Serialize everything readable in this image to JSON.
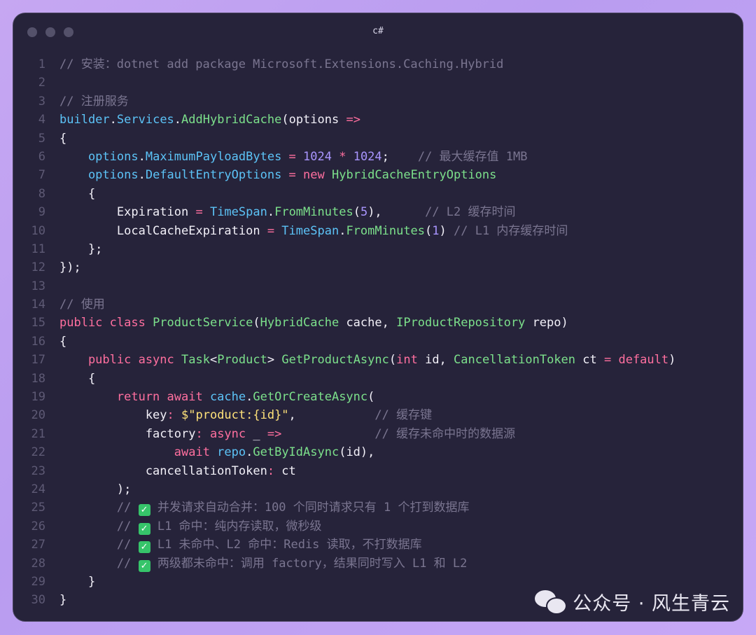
{
  "window": {
    "title": "c#"
  },
  "colors": {
    "background": "#26233a",
    "comment": "#7a7590",
    "keyword": "#ff6f9f",
    "type": "#7ce08b",
    "identifier": "#5cc3f7",
    "number": "#a995ff",
    "string": "#ffe27a"
  },
  "code": {
    "lines": [
      {
        "n": "1",
        "tokens": [
          {
            "t": "// 安装：dotnet add package Microsoft.Extensions.Caching.Hybrid",
            "c": "com"
          }
        ]
      },
      {
        "n": "2",
        "tokens": []
      },
      {
        "n": "3",
        "tokens": [
          {
            "t": "// 注册服务",
            "c": "com"
          }
        ]
      },
      {
        "n": "4",
        "tokens": [
          {
            "t": "builder",
            "c": "id"
          },
          {
            "t": ".",
            "c": "pl"
          },
          {
            "t": "Services",
            "c": "id"
          },
          {
            "t": ".",
            "c": "pl"
          },
          {
            "t": "AddHybridCache",
            "c": "fn"
          },
          {
            "t": "(options ",
            "c": "pl"
          },
          {
            "t": "=>",
            "c": "op"
          }
        ]
      },
      {
        "n": "5",
        "tokens": [
          {
            "t": "{",
            "c": "pl"
          }
        ]
      },
      {
        "n": "6",
        "tokens": [
          {
            "t": "    options",
            "c": "id"
          },
          {
            "t": ".",
            "c": "pl"
          },
          {
            "t": "MaximumPayloadBytes",
            "c": "id"
          },
          {
            "t": " = ",
            "c": "op"
          },
          {
            "t": "1024",
            "c": "num"
          },
          {
            "t": " * ",
            "c": "op"
          },
          {
            "t": "1024",
            "c": "num"
          },
          {
            "t": ";    ",
            "c": "pl"
          },
          {
            "t": "// 最大缓存值 1MB",
            "c": "com"
          }
        ]
      },
      {
        "n": "7",
        "tokens": [
          {
            "t": "    options",
            "c": "id"
          },
          {
            "t": ".",
            "c": "pl"
          },
          {
            "t": "DefaultEntryOptions",
            "c": "id"
          },
          {
            "t": " = ",
            "c": "op"
          },
          {
            "t": "new ",
            "c": "kw"
          },
          {
            "t": "HybridCacheEntryOptions",
            "c": "ty"
          }
        ]
      },
      {
        "n": "8",
        "tokens": [
          {
            "t": "    {",
            "c": "pl"
          }
        ]
      },
      {
        "n": "9",
        "tokens": [
          {
            "t": "        Expiration",
            "c": "pl"
          },
          {
            "t": " = ",
            "c": "op"
          },
          {
            "t": "TimeSpan",
            "c": "id"
          },
          {
            "t": ".",
            "c": "pl"
          },
          {
            "t": "FromMinutes",
            "c": "fn"
          },
          {
            "t": "(",
            "c": "pl"
          },
          {
            "t": "5",
            "c": "num"
          },
          {
            "t": "),      ",
            "c": "pl"
          },
          {
            "t": "// L2 缓存时间",
            "c": "com"
          }
        ]
      },
      {
        "n": "10",
        "tokens": [
          {
            "t": "        LocalCacheExpiration",
            "c": "pl"
          },
          {
            "t": " = ",
            "c": "op"
          },
          {
            "t": "TimeSpan",
            "c": "id"
          },
          {
            "t": ".",
            "c": "pl"
          },
          {
            "t": "FromMinutes",
            "c": "fn"
          },
          {
            "t": "(",
            "c": "pl"
          },
          {
            "t": "1",
            "c": "num"
          },
          {
            "t": ") ",
            "c": "pl"
          },
          {
            "t": "// L1 内存缓存时间",
            "c": "com"
          }
        ]
      },
      {
        "n": "11",
        "tokens": [
          {
            "t": "    };",
            "c": "pl"
          }
        ]
      },
      {
        "n": "12",
        "tokens": [
          {
            "t": "});",
            "c": "pl"
          }
        ]
      },
      {
        "n": "13",
        "tokens": []
      },
      {
        "n": "14",
        "tokens": [
          {
            "t": "// 使用",
            "c": "com"
          }
        ]
      },
      {
        "n": "15",
        "tokens": [
          {
            "t": "public class ",
            "c": "kw"
          },
          {
            "t": "ProductService",
            "c": "ty"
          },
          {
            "t": "(",
            "c": "pl"
          },
          {
            "t": "HybridCache",
            "c": "ty"
          },
          {
            "t": " cache, ",
            "c": "pl"
          },
          {
            "t": "IProductRepository",
            "c": "ty"
          },
          {
            "t": " repo)",
            "c": "pl"
          }
        ]
      },
      {
        "n": "16",
        "tokens": [
          {
            "t": "{",
            "c": "pl"
          }
        ]
      },
      {
        "n": "17",
        "tokens": [
          {
            "t": "    public async ",
            "c": "kw"
          },
          {
            "t": "Task",
            "c": "ty"
          },
          {
            "t": "<",
            "c": "pl"
          },
          {
            "t": "Product",
            "c": "ty"
          },
          {
            "t": "> ",
            "c": "pl"
          },
          {
            "t": "GetProductAsync",
            "c": "fn"
          },
          {
            "t": "(",
            "c": "pl"
          },
          {
            "t": "int",
            "c": "kw"
          },
          {
            "t": " id, ",
            "c": "pl"
          },
          {
            "t": "CancellationToken",
            "c": "ty"
          },
          {
            "t": " ct ",
            "c": "pl"
          },
          {
            "t": "= ",
            "c": "op"
          },
          {
            "t": "default",
            "c": "kw"
          },
          {
            "t": ")",
            "c": "pl"
          }
        ]
      },
      {
        "n": "18",
        "tokens": [
          {
            "t": "    {",
            "c": "pl"
          }
        ]
      },
      {
        "n": "19",
        "tokens": [
          {
            "t": "        return await ",
            "c": "kw"
          },
          {
            "t": "cache",
            "c": "id"
          },
          {
            "t": ".",
            "c": "pl"
          },
          {
            "t": "GetOrCreateAsync",
            "c": "fn"
          },
          {
            "t": "(",
            "c": "pl"
          }
        ]
      },
      {
        "n": "20",
        "tokens": [
          {
            "t": "            key",
            "c": "pl"
          },
          {
            "t": ": ",
            "c": "op"
          },
          {
            "t": "$\"product:{id}\"",
            "c": "str"
          },
          {
            "t": ",           ",
            "c": "pl"
          },
          {
            "t": "// 缓存键",
            "c": "com"
          }
        ]
      },
      {
        "n": "21",
        "tokens": [
          {
            "t": "            factory",
            "c": "pl"
          },
          {
            "t": ": ",
            "c": "op"
          },
          {
            "t": "async ",
            "c": "kw"
          },
          {
            "t": "_ ",
            "c": "pl"
          },
          {
            "t": "=>",
            "c": "op"
          },
          {
            "t": "             ",
            "c": "pl"
          },
          {
            "t": "// 缓存未命中时的数据源",
            "c": "com"
          }
        ]
      },
      {
        "n": "22",
        "tokens": [
          {
            "t": "                await ",
            "c": "kw"
          },
          {
            "t": "repo",
            "c": "id"
          },
          {
            "t": ".",
            "c": "pl"
          },
          {
            "t": "GetByIdAsync",
            "c": "fn"
          },
          {
            "t": "(id),",
            "c": "pl"
          }
        ]
      },
      {
        "n": "23",
        "tokens": [
          {
            "t": "            cancellationToken",
            "c": "pl"
          },
          {
            "t": ": ",
            "c": "op"
          },
          {
            "t": "ct",
            "c": "pl"
          }
        ]
      },
      {
        "n": "24",
        "tokens": [
          {
            "t": "        );",
            "c": "pl"
          }
        ]
      },
      {
        "n": "25",
        "tokens": [
          {
            "t": "        // ",
            "c": "com"
          },
          {
            "t": "✓",
            "c": "check"
          },
          {
            "t": " 并发请求自动合并：100 个同时请求只有 1 个打到数据库",
            "c": "com"
          }
        ]
      },
      {
        "n": "26",
        "tokens": [
          {
            "t": "        // ",
            "c": "com"
          },
          {
            "t": "✓",
            "c": "check"
          },
          {
            "t": " L1 命中：纯内存读取，微秒级",
            "c": "com"
          }
        ]
      },
      {
        "n": "27",
        "tokens": [
          {
            "t": "        // ",
            "c": "com"
          },
          {
            "t": "✓",
            "c": "check"
          },
          {
            "t": " L1 未命中、L2 命中：Redis 读取，不打数据库",
            "c": "com"
          }
        ]
      },
      {
        "n": "28",
        "tokens": [
          {
            "t": "        // ",
            "c": "com"
          },
          {
            "t": "✓",
            "c": "check"
          },
          {
            "t": " 两级都未命中：调用 factory，结果同时写入 L1 和 L2",
            "c": "com"
          }
        ]
      },
      {
        "n": "29",
        "tokens": [
          {
            "t": "    }",
            "c": "pl"
          }
        ]
      },
      {
        "n": "30",
        "tokens": [
          {
            "t": "}",
            "c": "pl"
          }
        ]
      }
    ]
  },
  "watermark": {
    "text": "公众号 · 风生青云",
    "icon": "wechat-icon"
  }
}
